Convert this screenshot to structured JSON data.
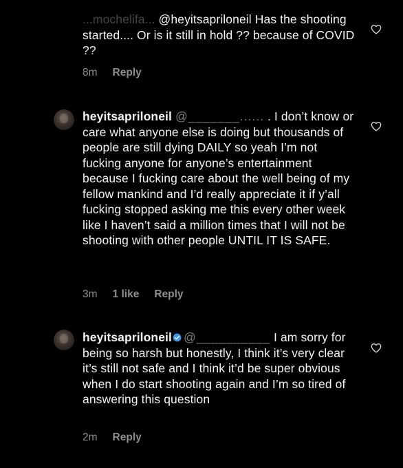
{
  "comments": [
    {
      "username_fragment": "...mochelifa...",
      "mention": "@heyitsapriloneil",
      "body": "Has the shooting started.... Or is it still in hold ?? because of COVID ??",
      "time": "8m",
      "likes": "",
      "reply_label": "Reply"
    },
    {
      "username": "heyitsapriloneil",
      "redacted_mention": "@_______......",
      "body": ". I don’t know or care what anyone else is doing but thousands of people are still dying DAILY so yeah I’m not fucking anyone for anyone’s entertainment because I fucking care about the well being of my fellow mankind and I’d really appreciate it if y’all fucking stopped asking me this every other week like I haven’t said a million times that I will not be shooting with other people UNTIL IT IS SAFE.",
      "time": "3m",
      "likes": "1 like",
      "reply_label": "Reply"
    },
    {
      "username": "heyitsapriloneil",
      "redacted_mention": "@__________",
      "body": "I am sorry for being so harsh but honestly, I think it’s very clear it’s still not safe and I think it’d be super obvious when I do start shooting again and I’m so tired of answering this question",
      "time": "2m",
      "likes": "",
      "reply_label": "Reply"
    }
  ],
  "icons": {
    "like": "heart-outline-icon",
    "verified": "verified-badge-icon"
  },
  "colors": {
    "background": "#000000",
    "text": "#f2f2f2",
    "meta": "#8e8e8e",
    "verified": "#3897f0"
  }
}
